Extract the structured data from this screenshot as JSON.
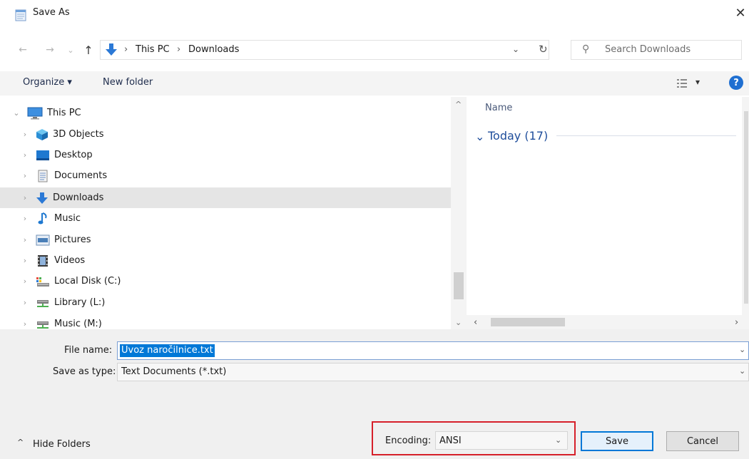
{
  "window": {
    "title": "Save As",
    "close_glyph": "✕"
  },
  "nav": {
    "back_glyph": "←",
    "forward_glyph": "→",
    "recent_glyph": "⌄",
    "up_glyph": "↑",
    "breadcrumb": [
      "This PC",
      "Downloads"
    ],
    "separator": "›",
    "dropdown_glyph": "⌄",
    "refresh_glyph": "↻",
    "search_placeholder": "Search Downloads",
    "search_glyph": "⚲"
  },
  "toolbar": {
    "organize": "Organize ▾",
    "new_folder": "New folder",
    "view_glyph": "▾",
    "help_glyph": "?"
  },
  "tree": {
    "items": [
      {
        "label": "This PC",
        "icon": "computer-icon",
        "expanded": true
      },
      {
        "label": "3D Objects",
        "icon": "3d-objects-icon"
      },
      {
        "label": "Desktop",
        "icon": "desktop-icon"
      },
      {
        "label": "Documents",
        "icon": "documents-icon"
      },
      {
        "label": "Downloads",
        "icon": "downloads-icon",
        "selected": true
      },
      {
        "label": "Music",
        "icon": "music-icon"
      },
      {
        "label": "Pictures",
        "icon": "pictures-icon"
      },
      {
        "label": "Videos",
        "icon": "videos-icon"
      },
      {
        "label": "Local Disk (C:)",
        "icon": "local-disk-icon"
      },
      {
        "label": "Library (L:)",
        "icon": "network-drive-icon"
      },
      {
        "label": "Music (M:)",
        "icon": "network-drive-icon"
      }
    ],
    "expand_glyph": "›",
    "collapse_glyph": "⌄"
  },
  "filelist": {
    "column_name": "Name",
    "group_label": "Today (17)",
    "group_glyph": "⌄"
  },
  "scroll": {
    "up": "^",
    "down": "⌄",
    "left": "‹",
    "right": "›"
  },
  "form": {
    "filename_label": "File name:",
    "filename_value": "Uvoz naročilnice.txt",
    "savetype_label": "Save as type:",
    "savetype_value": "Text Documents (*.txt)",
    "encoding_label": "Encoding:",
    "encoding_value": "ANSI",
    "save": "Save",
    "cancel": "Cancel",
    "hide_folders": "Hide Folders",
    "hide_glyph": "^",
    "combo_glyph": "⌄"
  },
  "colors": {
    "accent": "#0078d7",
    "group_blue": "#1e4d9b",
    "highlight": "#d6202a",
    "selection": "#e5e5e5"
  }
}
